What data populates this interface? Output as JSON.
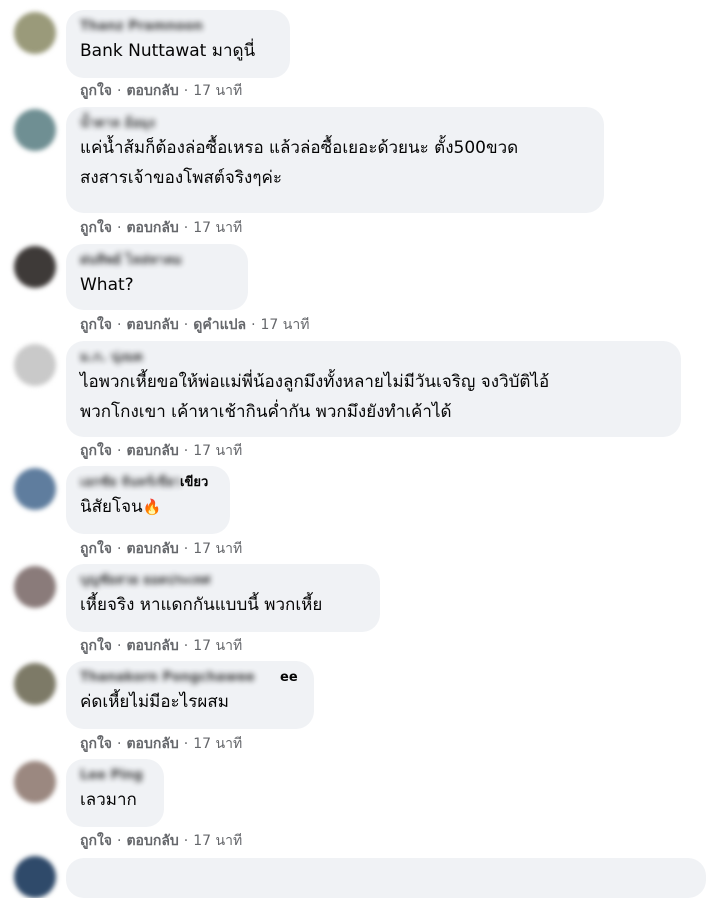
{
  "comments": [
    {
      "author": "Thanz Pramnoon",
      "text_lines": [
        "Bank Nuttawat มาดูนี่"
      ],
      "actions": {
        "like": "ถูกใจ",
        "reply": "ตอบกลับ",
        "time": "17 นาที"
      }
    },
    {
      "author": "น้ำตาล อ้อมุง",
      "text_lines": [
        "แค่น้ำส้มก็ต้องล่อซื้อเหรอ แล้วล่อซื้อเยอะด้วยนะ ตั้ง500ขวด",
        "สงสารเจ้าของโพสต์จริงๆค่ะ"
      ],
      "actions": {
        "like": "ถูกใจ",
        "reply": "ตอบกลับ",
        "time": "17 นาที"
      }
    },
    {
      "author": "ฝนทิพย์ ไหล่ทาคม",
      "text_lines": [
        "What?"
      ],
      "actions": {
        "like": "ถูกใจ",
        "reply": "ตอบกลับ",
        "translate": "ดูคำแปล",
        "time": "17 นาที"
      }
    },
    {
      "author": "ม.ก. นุ่งมด",
      "text_lines": [
        "ไอพวกเหี้ยขอให้พ่อแม่พี่น้องลูกมึงทั้งหลายไม่มีวันเจริญ จงวิบัติไอ้",
        "พวกโกงเขา เค้าหาเช้ากินค่ำกัน พวกมึงยังทำเค้าได้"
      ],
      "actions": {
        "like": "ถูกใจ",
        "reply": "ตอบกลับ",
        "time": "17 นาที"
      }
    },
    {
      "author": "เอกชัย จันทร์เขียว",
      "author_visible": "เขียว",
      "text_lines": [
        "นิสัยโจน"
      ],
      "emoji": "🔥",
      "actions": {
        "like": "ถูกใจ",
        "reply": "ตอบกลับ",
        "time": "17 นาที"
      }
    },
    {
      "author": "บุญชัยสวย ยอดประเทศ",
      "text_lines": [
        "เหี้ยจริง หาแดกกันแบบนี้ พวกเหี้ย"
      ],
      "actions": {
        "like": "ถูกใจ",
        "reply": "ตอบกลับ",
        "time": "17 นาที"
      }
    },
    {
      "author": "Thanakorn Pongchawee",
      "author_visible": "ee",
      "text_lines": [
        "ค่ดเหี้ยไม่มีอะไรผสม"
      ],
      "actions": {
        "like": "ถูกใจ",
        "reply": "ตอบกลับ",
        "time": "17 นาที"
      }
    },
    {
      "author": "Lee Ping",
      "text_lines": [
        "เลวมาก"
      ],
      "actions": {
        "like": "ถูกใจ",
        "reply": "ตอบกลับ",
        "time": "17 นาที"
      }
    }
  ],
  "avatar_colors": [
    "#9a9a7a",
    "#6f8f93",
    "#3e3a38",
    "#c9c9c9",
    "#5f7d9e",
    "#8a7b7a",
    "#7d7a67",
    "#9b8880",
    "#2f4a6a"
  ]
}
